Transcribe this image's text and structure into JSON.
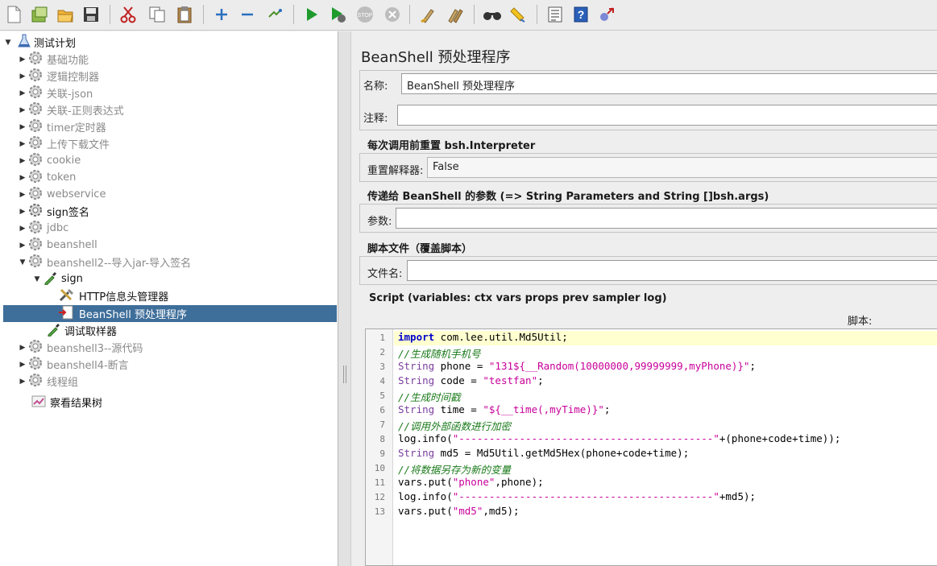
{
  "toolbar": {
    "icons": [
      "new-file-icon",
      "templates-icon",
      "open-icon",
      "save-icon",
      "cut-icon",
      "copy-icon",
      "paste-icon",
      "expand-icon",
      "collapse-icon",
      "toggle-icon",
      "start-icon",
      "start-no-pause-icon",
      "stop-icon",
      "shutdown-icon",
      "clear-icon",
      "clear-all-icon",
      "search-icon",
      "reset-search-icon",
      "function-helper-icon",
      "help-icon",
      "remote-icon"
    ]
  },
  "tree": {
    "root": "测试计划",
    "items": [
      {
        "label": "基础功能",
        "dim": true
      },
      {
        "label": "逻辑控制器",
        "dim": true
      },
      {
        "label": "关联-json",
        "dim": true
      },
      {
        "label": "关联-正则表达式",
        "dim": true
      },
      {
        "label": "timer定时器",
        "dim": true
      },
      {
        "label": "上传下载文件",
        "dim": true
      },
      {
        "label": "cookie",
        "dim": true
      },
      {
        "label": "token",
        "dim": true
      },
      {
        "label": "webservice",
        "dim": true
      },
      {
        "label": "sign签名",
        "dim": false
      },
      {
        "label": "jdbc",
        "dim": true
      },
      {
        "label": "beanshell",
        "dim": true
      },
      {
        "label": "beanshell2--导入jar-导入签名",
        "dim": true
      },
      {
        "label": "sign",
        "dim": false
      },
      {
        "label": "HTTP信息头管理器",
        "dim": false
      },
      {
        "label": "BeanShell 预处理程序",
        "dim": false
      },
      {
        "label": "调试取样器",
        "dim": false
      },
      {
        "label": "beanshell3--源代码",
        "dim": true
      },
      {
        "label": "beanshell4-断言",
        "dim": true
      },
      {
        "label": "线程组",
        "dim": true
      },
      {
        "label": "察看结果树",
        "dim": false
      }
    ]
  },
  "panel": {
    "title": "BeanShell 预处理程序",
    "name_label": "名称:",
    "name_value": "BeanShell 预处理程序",
    "comment_label": "注释:",
    "comment_value": "",
    "reset_section": "每次调用前重置 bsh.Interpreter",
    "reset_label": "重置解释器:",
    "reset_value": "False",
    "params_section": "传递给 BeanShell 的参数 (=> String Parameters and String []bsh.args)",
    "params_label": "参数:",
    "params_value": "",
    "script_file_section": "脚本文件（覆盖脚本）",
    "filename_label": "文件名:",
    "filename_value": "",
    "script_section": "Script (variables: ctx vars props prev sampler log)",
    "script_header": "脚本:"
  },
  "script": {
    "lines": [
      "import com.lee.util.Md5Util;",
      "//生成随机手机号",
      "String phone = \"131${__Random(10000000,99999999,myPhone)}\";",
      "String code = \"testfan\";",
      "//生成时间戳",
      "String time = \"${__time(,myTime)}\";",
      "//调用外部函数进行加密",
      "log.info(\"------------------------------------------\"+(phone+code+time));",
      "String md5 = Md5Util.getMd5Hex(phone+code+time);",
      "//将数据另存为新的变量",
      "vars.put(\"phone\",phone);",
      "log.info(\"------------------------------------------\"+md5);",
      "vars.put(\"md5\",md5);"
    ]
  }
}
